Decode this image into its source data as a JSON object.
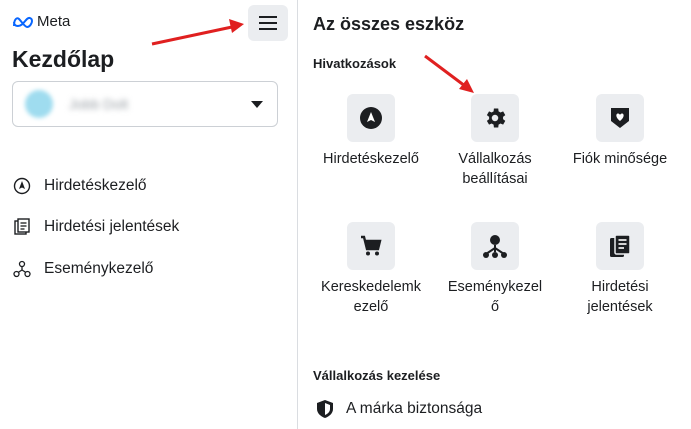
{
  "header": {
    "logo_text": "Meta",
    "title": "Kezdőlap"
  },
  "account": {
    "name": "Jobb Dolt"
  },
  "sidebar": {
    "items": [
      {
        "label": "Hirdetéskezelő",
        "icon": "compass-icon"
      },
      {
        "label": "Hirdetési jelentések",
        "icon": "report-icon"
      },
      {
        "label": "Eseménykezelő",
        "icon": "events-icon"
      }
    ]
  },
  "main": {
    "title": "Az összes eszköz",
    "shortcuts_title": "Hivatkozások",
    "tiles": [
      {
        "label": "Hirdetéskezelő",
        "icon": "compass-icon"
      },
      {
        "label": "Vállalkozás beállításai",
        "icon": "gear-icon"
      },
      {
        "label": "Fiók minősége",
        "icon": "shield-heart-icon"
      },
      {
        "label": "Kereskedelemkezelő",
        "icon": "cart-icon"
      },
      {
        "label": "Eseménykezelő",
        "icon": "events-icon"
      },
      {
        "label": "Hirdetési jelentések",
        "icon": "report-icon"
      }
    ],
    "manage_title": "Vállalkozás kezelése",
    "manage_items": [
      {
        "label": "A márka biztonsága",
        "icon": "shield-icon"
      }
    ]
  },
  "colors": {
    "arrow": "#e02020",
    "tile_bg": "#ebedf0",
    "logo": "#0866ff"
  }
}
